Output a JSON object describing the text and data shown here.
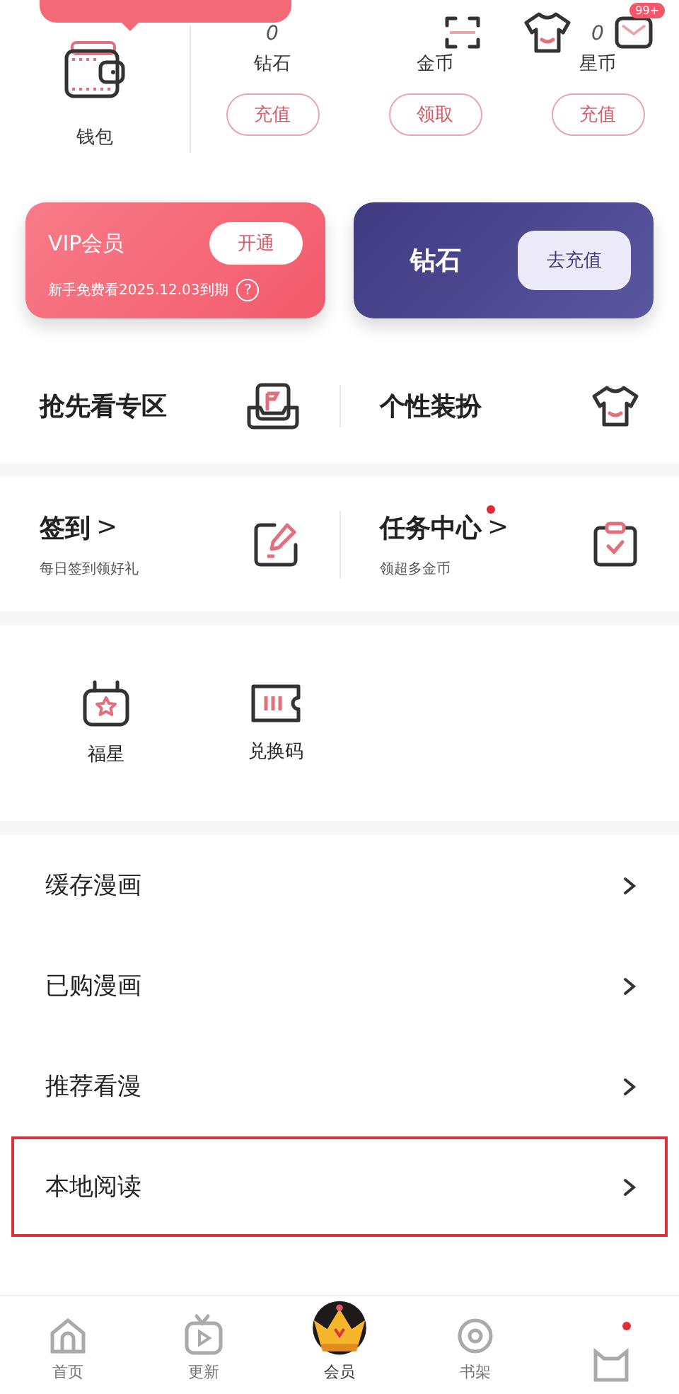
{
  "wallet": {
    "label": "钱包"
  },
  "currencies": [
    {
      "value": "0",
      "label": "钻石",
      "action": "充值"
    },
    {
      "label": "金币",
      "action": "领取"
    },
    {
      "value": "0",
      "label": "星币",
      "action": "充值"
    }
  ],
  "mail_badge": "99+",
  "vip_card": {
    "title": "VIP会员",
    "button": "开通",
    "note": "新手免费看2025.12.03到期",
    "help": "?"
  },
  "diamond_card": {
    "title": "钻石",
    "button": "去充值"
  },
  "features": [
    {
      "label": "抢先看专区",
      "kind": "play"
    },
    {
      "label": "个性装扮",
      "kind": "shirt"
    }
  ],
  "tasks": [
    {
      "title": "签到",
      "chevron": ">",
      "subtitle": "每日签到领好礼",
      "kind": "pen"
    },
    {
      "title": "任务中心",
      "chevron": ">",
      "subtitle": "领超多金币",
      "dot": true,
      "kind": "clipboard"
    }
  ],
  "shortcuts": [
    {
      "label": "福星",
      "kind": "bag"
    },
    {
      "label": "兑换码",
      "kind": "ticket"
    }
  ],
  "menu": [
    {
      "label": "缓存漫画",
      "highlighted": false
    },
    {
      "label": "已购漫画",
      "highlighted": false
    },
    {
      "label": "推荐看漫",
      "highlighted": false
    },
    {
      "label": "本地阅读",
      "highlighted": true
    }
  ],
  "tabs": [
    {
      "label": "首页",
      "kind": "home",
      "selected": false
    },
    {
      "label": "更新",
      "kind": "tv",
      "selected": false
    },
    {
      "label": "会员",
      "kind": "crown",
      "selected": true
    },
    {
      "label": "书架",
      "kind": "disc",
      "selected": false
    },
    {
      "kind": "cat",
      "selected": false,
      "dot": true
    }
  ]
}
